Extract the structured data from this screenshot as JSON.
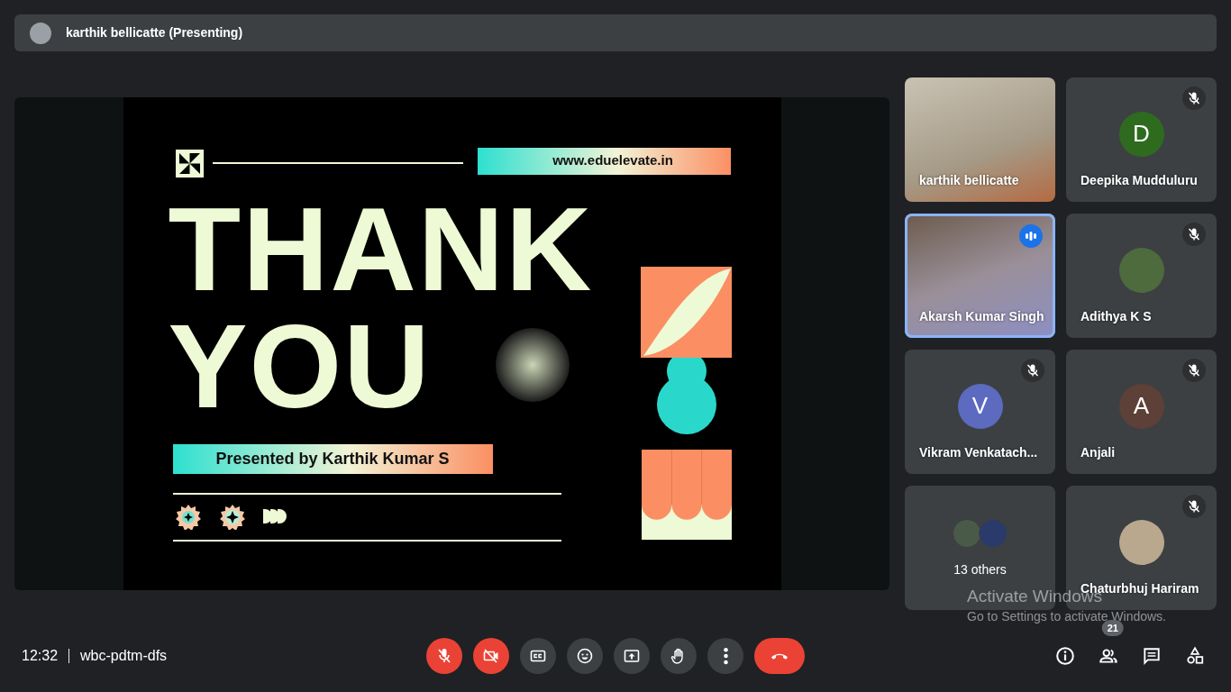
{
  "presenter_bar": {
    "text": "karthik bellicatte (Presenting)"
  },
  "slide": {
    "url": "www.eduelevate.in",
    "title_lines": [
      "THANK",
      "YOU"
    ],
    "presented_by": "Presented by Karthik Kumar S"
  },
  "tiles": [
    {
      "kind": "video",
      "name": "karthik bellicatte",
      "muted": false,
      "speaking": false
    },
    {
      "kind": "initial",
      "name": "Deepika Mudduluru",
      "initial": "D",
      "color": "#2e6b1f",
      "muted": true,
      "speaking": false
    },
    {
      "kind": "video",
      "name": "Akarsh Kumar Singh",
      "muted": false,
      "speaking": true
    },
    {
      "kind": "photo",
      "name": "Adithya K S",
      "muted": true,
      "speaking": false
    },
    {
      "kind": "initial",
      "name": "Vikram Venkatach...",
      "initial": "V",
      "color": "#5c6bc0",
      "muted": true,
      "speaking": false
    },
    {
      "kind": "initial",
      "name": "Anjali",
      "initial": "A",
      "color": "#5d4037",
      "muted": true,
      "speaking": false
    },
    {
      "kind": "others",
      "name": "13 others",
      "muted": false,
      "speaking": false
    },
    {
      "kind": "photo",
      "name": "Chaturbhuj Hariram",
      "muted": true,
      "speaking": false
    }
  ],
  "windows_notice": {
    "title": "Activate Windows",
    "text": "Go to Settings to activate Windows."
  },
  "meeting": {
    "time": "12:32",
    "code": "wbc-pdtm-dfs"
  },
  "controls": [
    {
      "kind": "mic",
      "on": false
    },
    {
      "kind": "camera",
      "on": false
    },
    {
      "kind": "captions"
    },
    {
      "kind": "reactions"
    },
    {
      "kind": "present"
    },
    {
      "kind": "hand"
    },
    {
      "kind": "more"
    },
    {
      "kind": "hangup"
    }
  ],
  "side_buttons": [
    {
      "kind": "info"
    },
    {
      "kind": "people",
      "badge": "21"
    },
    {
      "kind": "chat"
    },
    {
      "kind": "activities"
    }
  ]
}
